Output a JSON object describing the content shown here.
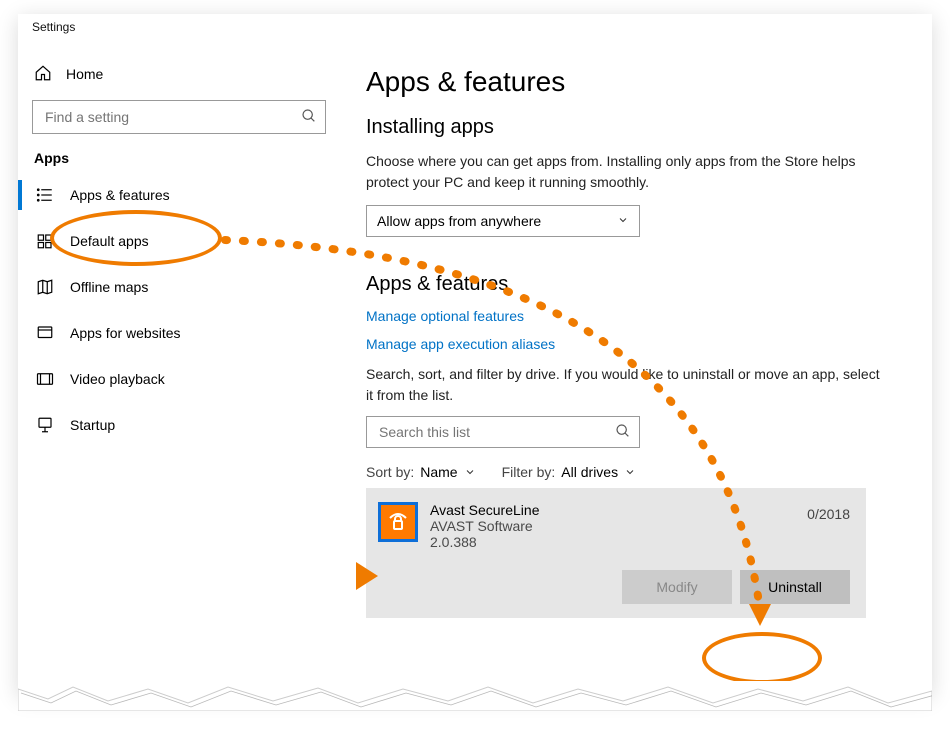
{
  "window": {
    "title": "Settings"
  },
  "sidebar": {
    "home": "Home",
    "search_placeholder": "Find a setting",
    "category": "Apps",
    "items": [
      {
        "label": "Apps & features"
      },
      {
        "label": "Default apps"
      },
      {
        "label": "Offline maps"
      },
      {
        "label": "Apps for websites"
      },
      {
        "label": "Video playback"
      },
      {
        "label": "Startup"
      }
    ]
  },
  "main": {
    "page_title": "Apps & features",
    "install_section": {
      "heading": "Installing apps",
      "desc": "Choose where you can get apps from. Installing only apps from the Store helps protect your PC and keep it running smoothly.",
      "dropdown_value": "Allow apps from anywhere"
    },
    "apps_section": {
      "heading": "Apps & features",
      "link1": "Manage optional features",
      "link2": "Manage app execution aliases",
      "desc2": "Search, sort, and filter by drive. If you would like to uninstall or move an app, select it from the list.",
      "search_placeholder": "Search this list",
      "sort_label": "Sort by:",
      "sort_value": "Name",
      "filter_label": "Filter by:",
      "filter_value": "All drives"
    },
    "app": {
      "name": "Avast SecureLine",
      "vendor": "AVAST Software",
      "version": "2.0.388",
      "date": "0/2018",
      "modify": "Modify",
      "uninstall": "Uninstall"
    }
  }
}
